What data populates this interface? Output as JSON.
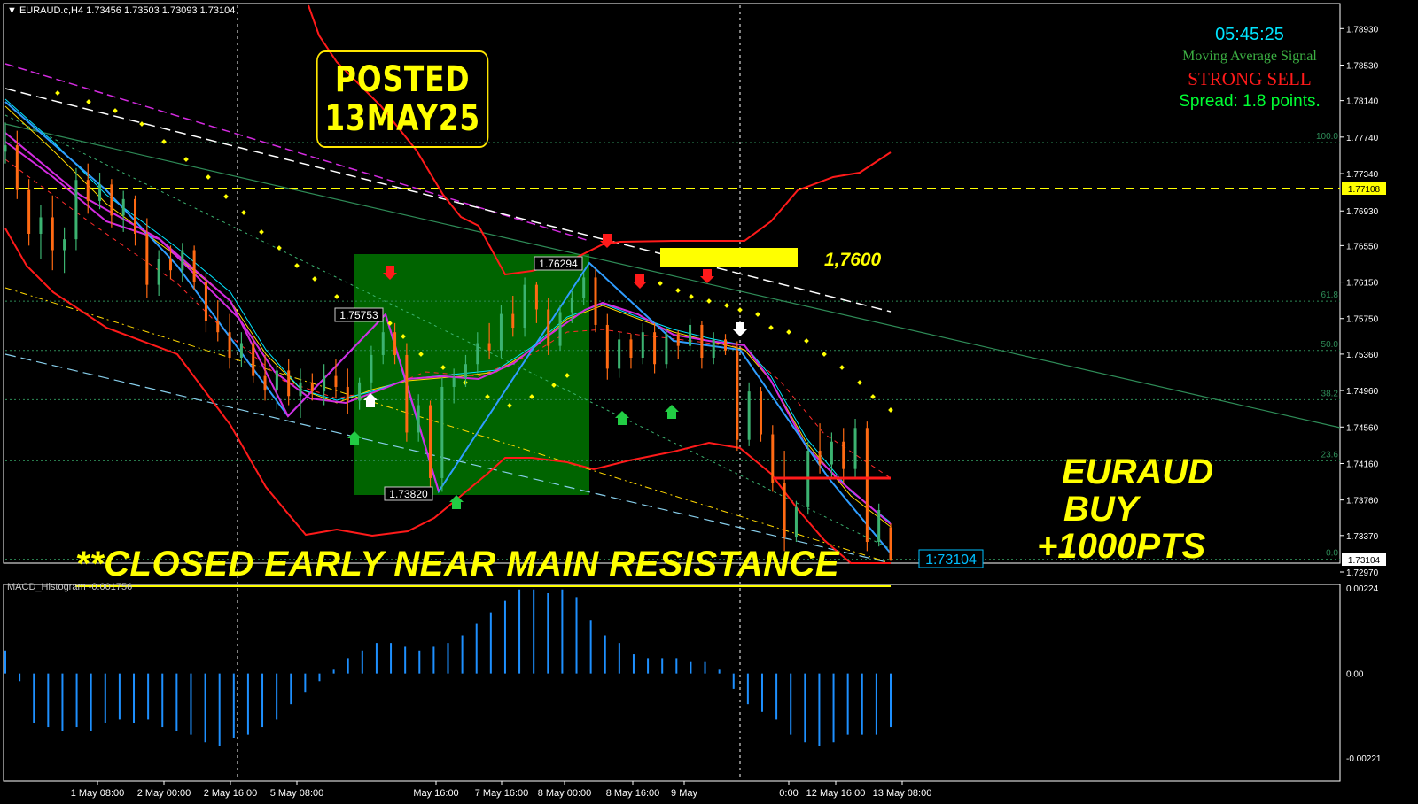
{
  "symbol_bar": {
    "symbol": "EURAUD.c,H4",
    "ohlc": "1.73456 1.73503 1.73093 1.73104"
  },
  "annotations": {
    "posted_line1": "POSTED",
    "posted_line2": "13MAY25",
    "level_label": "1,7600",
    "trade_call_line1": "EURAUD",
    "trade_call_line2": "BUY",
    "trade_call_line3": "+1000PTS",
    "closed_banner": "**CLOSED EARLY NEAR MAIN RESISTANCE"
  },
  "signal_panel": {
    "clock": "05:45:25",
    "ma_signal": "Moving Average Signal",
    "signal": "STRONG SELL",
    "spread": "Spread: 1.8 points."
  },
  "macd_label": "MACD_Histogram -0.001756",
  "colors": {
    "background": "#000000",
    "bull": "#3cb371",
    "bear": "#ff6a13",
    "bollinger": "#ff1a1a",
    "zigzag": "#2f9dff",
    "ma_magenta": "#d42be0",
    "fib": "#2e8b57",
    "highlight": "#ffff00",
    "zone": "#006400",
    "macd": "#1e90ff"
  },
  "chart_data": {
    "type": "candlestick",
    "instrument": "EURAUD.c",
    "timeframe": "H4",
    "price_axis_ticks": [
      "1.78930",
      "1.78530",
      "1.78140",
      "1.77740",
      "1.77340",
      "1.76930",
      "1.76550",
      "1.76150",
      "1.75750",
      "1.75360",
      "1.74960",
      "1.74560",
      "1.74160",
      "1.73760",
      "1.73370",
      "1.72970"
    ],
    "price_range": [
      1.7297,
      1.7903
    ],
    "time_axis_ticks": [
      "1 May 08:00",
      "2 May 00:00",
      "2 May 16:00",
      "5 May 08:00",
      "May 16:00",
      "7 May 16:00",
      "8 May 00:00",
      "8 May 16:00",
      "9 May",
      "0:00",
      "12 May 16:00",
      "13 May 08:00"
    ],
    "current_price_label": "1.73104",
    "current_price_tag": "1:73104",
    "resistance_price_label": "1.77108",
    "fib_levels": [
      {
        "label": "100.0",
        "price": 1.7768
      },
      {
        "label": "61.8",
        "price": 1.7594
      },
      {
        "label": "50.0",
        "price": 1.754
      },
      {
        "label": "38.2",
        "price": 1.7486
      },
      {
        "label": "23.6",
        "price": 1.7419
      },
      {
        "label": "0.0",
        "price": 1.7311
      }
    ],
    "zigzag_labels": [
      {
        "label": "1.75753",
        "price": 1.75753
      },
      {
        "label": "1.73820",
        "price": 1.7382
      },
      {
        "label": "1.76294",
        "price": 1.76294
      }
    ],
    "candles": [
      {
        "o": 1.7758,
        "h": 1.779,
        "l": 1.7745,
        "c": 1.7765
      },
      {
        "o": 1.7765,
        "h": 1.7781,
        "l": 1.7706,
        "c": 1.7716
      },
      {
        "o": 1.7716,
        "h": 1.7728,
        "l": 1.7655,
        "c": 1.7668
      },
      {
        "o": 1.7668,
        "h": 1.77,
        "l": 1.764,
        "c": 1.7686
      },
      {
        "o": 1.7686,
        "h": 1.771,
        "l": 1.7628,
        "c": 1.765
      },
      {
        "o": 1.765,
        "h": 1.7675,
        "l": 1.7625,
        "c": 1.7662
      },
      {
        "o": 1.7662,
        "h": 1.774,
        "l": 1.765,
        "c": 1.7727
      },
      {
        "o": 1.7727,
        "h": 1.7745,
        "l": 1.769,
        "c": 1.7704
      },
      {
        "o": 1.7704,
        "h": 1.7735,
        "l": 1.7695,
        "c": 1.7722
      },
      {
        "o": 1.7722,
        "h": 1.7728,
        "l": 1.7675,
        "c": 1.7688
      },
      {
        "o": 1.7688,
        "h": 1.7715,
        "l": 1.767,
        "c": 1.7706
      },
      {
        "o": 1.7706,
        "h": 1.771,
        "l": 1.7655,
        "c": 1.7668
      },
      {
        "o": 1.7668,
        "h": 1.7685,
        "l": 1.7598,
        "c": 1.7612
      },
      {
        "o": 1.7612,
        "h": 1.765,
        "l": 1.76,
        "c": 1.764
      },
      {
        "o": 1.764,
        "h": 1.7655,
        "l": 1.7618,
        "c": 1.7628
      },
      {
        "o": 1.7628,
        "h": 1.7658,
        "l": 1.7615,
        "c": 1.765
      },
      {
        "o": 1.765,
        "h": 1.7655,
        "l": 1.7606,
        "c": 1.7615
      },
      {
        "o": 1.7615,
        "h": 1.7625,
        "l": 1.756,
        "c": 1.7572
      },
      {
        "o": 1.7572,
        "h": 1.7595,
        "l": 1.755,
        "c": 1.756
      },
      {
        "o": 1.756,
        "h": 1.758,
        "l": 1.752,
        "c": 1.7532
      },
      {
        "o": 1.7532,
        "h": 1.756,
        "l": 1.7522,
        "c": 1.7548
      },
      {
        "o": 1.7548,
        "h": 1.7555,
        "l": 1.7505,
        "c": 1.7512
      },
      {
        "o": 1.7512,
        "h": 1.7535,
        "l": 1.7485,
        "c": 1.7496
      },
      {
        "o": 1.7496,
        "h": 1.7525,
        "l": 1.7475,
        "c": 1.7518
      },
      {
        "o": 1.7518,
        "h": 1.753,
        "l": 1.748,
        "c": 1.749
      },
      {
        "o": 1.749,
        "h": 1.752,
        "l": 1.7466,
        "c": 1.7505
      },
      {
        "o": 1.7505,
        "h": 1.7515,
        "l": 1.7485,
        "c": 1.7495
      },
      {
        "o": 1.7495,
        "h": 1.7525,
        "l": 1.748,
        "c": 1.7512
      },
      {
        "o": 1.7512,
        "h": 1.753,
        "l": 1.7488,
        "c": 1.75
      },
      {
        "o": 1.75,
        "h": 1.752,
        "l": 1.747,
        "c": 1.7485
      },
      {
        "o": 1.7485,
        "h": 1.751,
        "l": 1.7475,
        "c": 1.7505
      },
      {
        "o": 1.7505,
        "h": 1.7545,
        "l": 1.7495,
        "c": 1.7535
      },
      {
        "o": 1.7535,
        "h": 1.7575,
        "l": 1.7525,
        "c": 1.756
      },
      {
        "o": 1.756,
        "h": 1.757,
        "l": 1.7525,
        "c": 1.7535
      },
      {
        "o": 1.7535,
        "h": 1.7548,
        "l": 1.744,
        "c": 1.745
      },
      {
        "o": 1.745,
        "h": 1.7492,
        "l": 1.744,
        "c": 1.748
      },
      {
        "o": 1.748,
        "h": 1.7485,
        "l": 1.7382,
        "c": 1.74
      },
      {
        "o": 1.74,
        "h": 1.751,
        "l": 1.7385,
        "c": 1.75
      },
      {
        "o": 1.75,
        "h": 1.752,
        "l": 1.7482,
        "c": 1.751
      },
      {
        "o": 1.751,
        "h": 1.7535,
        "l": 1.75,
        "c": 1.7525
      },
      {
        "o": 1.7525,
        "h": 1.756,
        "l": 1.7515,
        "c": 1.7548
      },
      {
        "o": 1.7548,
        "h": 1.757,
        "l": 1.753,
        "c": 1.754
      },
      {
        "o": 1.754,
        "h": 1.759,
        "l": 1.7532,
        "c": 1.758
      },
      {
        "o": 1.758,
        "h": 1.76,
        "l": 1.7555,
        "c": 1.7565
      },
      {
        "o": 1.7565,
        "h": 1.762,
        "l": 1.7555,
        "c": 1.7612
      },
      {
        "o": 1.7612,
        "h": 1.7615,
        "l": 1.757,
        "c": 1.7585
      },
      {
        "o": 1.7585,
        "h": 1.7598,
        "l": 1.7535,
        "c": 1.7545
      },
      {
        "o": 1.7545,
        "h": 1.759,
        "l": 1.754,
        "c": 1.7582
      },
      {
        "o": 1.7582,
        "h": 1.7605,
        "l": 1.757,
        "c": 1.7598
      },
      {
        "o": 1.7598,
        "h": 1.7625,
        "l": 1.759,
        "c": 1.762
      },
      {
        "o": 1.762,
        "h": 1.7629,
        "l": 1.756,
        "c": 1.7568
      },
      {
        "o": 1.7568,
        "h": 1.758,
        "l": 1.7508,
        "c": 1.752
      },
      {
        "o": 1.752,
        "h": 1.756,
        "l": 1.751,
        "c": 1.7552
      },
      {
        "o": 1.7552,
        "h": 1.7558,
        "l": 1.752,
        "c": 1.7532
      },
      {
        "o": 1.7532,
        "h": 1.757,
        "l": 1.7525,
        "c": 1.756
      },
      {
        "o": 1.756,
        "h": 1.757,
        "l": 1.7515,
        "c": 1.7525
      },
      {
        "o": 1.7525,
        "h": 1.7565,
        "l": 1.752,
        "c": 1.7558
      },
      {
        "o": 1.7558,
        "h": 1.7562,
        "l": 1.753,
        "c": 1.7545
      },
      {
        "o": 1.7545,
        "h": 1.7575,
        "l": 1.754,
        "c": 1.7568
      },
      {
        "o": 1.7568,
        "h": 1.7572,
        "l": 1.752,
        "c": 1.7532
      },
      {
        "o": 1.7532,
        "h": 1.756,
        "l": 1.7525,
        "c": 1.7552
      },
      {
        "o": 1.7552,
        "h": 1.7558,
        "l": 1.7535,
        "c": 1.754
      },
      {
        "o": 1.754,
        "h": 1.755,
        "l": 1.743,
        "c": 1.7442
      },
      {
        "o": 1.7442,
        "h": 1.7505,
        "l": 1.7435,
        "c": 1.7495
      },
      {
        "o": 1.7495,
        "h": 1.75,
        "l": 1.744,
        "c": 1.7448
      },
      {
        "o": 1.7448,
        "h": 1.7458,
        "l": 1.7385,
        "c": 1.7395
      },
      {
        "o": 1.7395,
        "h": 1.743,
        "l": 1.732,
        "c": 1.7335
      },
      {
        "o": 1.7335,
        "h": 1.7375,
        "l": 1.733,
        "c": 1.7368
      },
      {
        "o": 1.7368,
        "h": 1.744,
        "l": 1.736,
        "c": 1.743
      },
      {
        "o": 1.743,
        "h": 1.746,
        "l": 1.7405,
        "c": 1.7415
      },
      {
        "o": 1.7415,
        "h": 1.745,
        "l": 1.74,
        "c": 1.744
      },
      {
        "o": 1.744,
        "h": 1.7455,
        "l": 1.7395,
        "c": 1.741
      },
      {
        "o": 1.741,
        "h": 1.7465,
        "l": 1.74,
        "c": 1.7455
      },
      {
        "o": 1.7455,
        "h": 1.7462,
        "l": 1.732,
        "c": 1.733
      },
      {
        "o": 1.733,
        "h": 1.7372,
        "l": 1.7325,
        "c": 1.7365
      },
      {
        "o": 1.7346,
        "h": 1.735,
        "l": 1.7309,
        "c": 1.731
      }
    ],
    "macd": {
      "label": "MACD_Histogram -0.001756",
      "axis_ticks": [
        "0.00224",
        "0.00",
        "-0.00221"
      ],
      "range": [
        -0.00221,
        0.00224
      ],
      "values": [
        0.0006,
        -0.0002,
        -0.0013,
        -0.0014,
        -0.0015,
        -0.0014,
        -0.0015,
        -0.0013,
        -0.0012,
        -0.0013,
        -0.0012,
        -0.0014,
        -0.0015,
        -0.0016,
        -0.0018,
        -0.0019,
        -0.0017,
        -0.0016,
        -0.0014,
        -0.0012,
        -0.0008,
        -0.0005,
        -0.0002,
        0.0001,
        0.0004,
        0.0006,
        0.0008,
        0.0008,
        0.0007,
        0.0006,
        0.0007,
        0.0008,
        0.001,
        0.0013,
        0.0016,
        0.0019,
        0.0022,
        0.0022,
        0.0021,
        0.0022,
        0.002,
        0.0014,
        0.001,
        0.0008,
        0.0005,
        0.0004,
        0.0004,
        0.0004,
        0.0003,
        0.0003,
        0.0001,
        -0.0004,
        -0.0008,
        -0.001,
        -0.0012,
        -0.0016,
        -0.0018,
        -0.0019,
        -0.0018,
        -0.0016,
        -0.0016,
        -0.0016,
        -0.0014
      ]
    }
  }
}
